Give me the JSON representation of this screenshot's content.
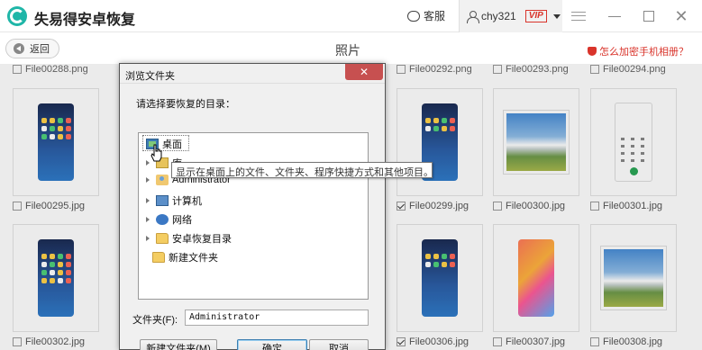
{
  "app": {
    "title": "失易得安卓恢复",
    "service_label": "客服",
    "username": "chy321",
    "vip_label": "VIP"
  },
  "header": {
    "back_label": "返回",
    "page_title": "照片",
    "encrypt_link": "怎么加密手机相册？"
  },
  "grid": {
    "top_labels": [
      "File00288.png",
      "File00292.png",
      "File00293.png",
      "File00294.png"
    ],
    "row1": [
      {
        "label": "File00295.jpg",
        "checked": false,
        "kind": "phone-blue"
      },
      {
        "label": "File00299.jpg",
        "checked": true,
        "kind": "phone-blue"
      },
      {
        "label": "File00300.jpg",
        "checked": false,
        "kind": "landscape"
      },
      {
        "label": "File00301.jpg",
        "checked": false,
        "kind": "dialer"
      }
    ],
    "row2": [
      {
        "label": "File00302.jpg",
        "checked": false,
        "kind": "phone-blue"
      },
      {
        "label": "File00306.jpg",
        "checked": true,
        "kind": "phone-blue"
      },
      {
        "label": "File00307.jpg",
        "checked": false,
        "kind": "phone-rainbow"
      },
      {
        "label": "File00308.jpg",
        "checked": false,
        "kind": "landscape"
      }
    ]
  },
  "dialog": {
    "title": "浏览文件夹",
    "prompt": "请选择要恢复的目录：",
    "tree": [
      {
        "label": "桌面",
        "icon": "desktop-icon",
        "expandable": false
      },
      {
        "label": "库",
        "icon": "library-icon",
        "expandable": true
      },
      {
        "label": "Administrator",
        "icon": "user-folder-icon",
        "expandable": true
      },
      {
        "label": "计算机",
        "icon": "computer-icon",
        "expandable": true
      },
      {
        "label": "网络",
        "icon": "network-icon",
        "expandable": true
      },
      {
        "label": "安卓恢复目录",
        "icon": "folder-icon",
        "expandable": true
      },
      {
        "label": "新建文件夹",
        "icon": "folder-icon",
        "expandable": false
      }
    ],
    "tooltip": "显示在桌面上的文件、文件夹、程序快捷方式和其他项目。",
    "folder_label": "文件夹(F):",
    "folder_value": "Administrator",
    "new_folder_button": "新建文件夹(M)",
    "ok_button": "确定",
    "cancel_button": "取消"
  }
}
